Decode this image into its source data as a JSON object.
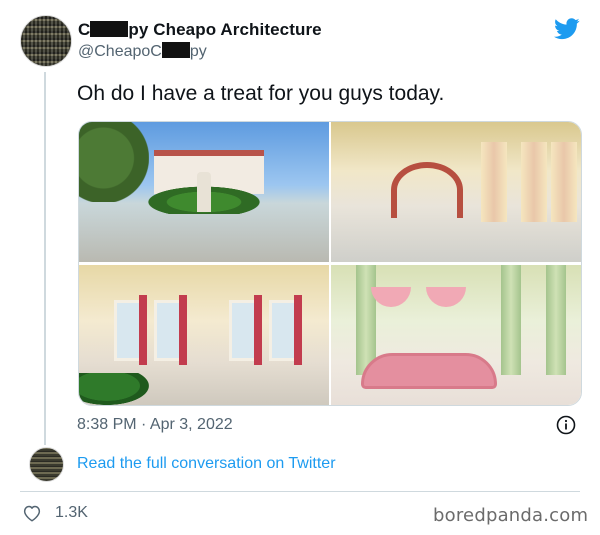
{
  "tweet": {
    "display_name_prefix": "C",
    "display_name_suffix": "py Cheapo Architecture",
    "handle_prefix": "@CheapoC",
    "handle_suffix": "py",
    "text": "Oh do I have a treat for you guys today.",
    "timestamp": "8:38 PM · Apr 3, 2022",
    "read_conversation_label": "Read the full conversation on Twitter",
    "likes_count": "1.3K"
  },
  "photos": [
    {
      "name": "photo-mansion-exterior"
    },
    {
      "name": "photo-grand-hall"
    },
    {
      "name": "photo-ballroom"
    },
    {
      "name": "photo-pink-lounge"
    }
  ],
  "watermark": "boredpanda.com",
  "colors": {
    "link_blue": "#1d9bf0",
    "secondary_text": "#536471",
    "twitter_blue": "#1d9bf0"
  },
  "icons": {
    "brand": "twitter-bird-icon",
    "info": "info-icon",
    "like": "heart-icon"
  }
}
